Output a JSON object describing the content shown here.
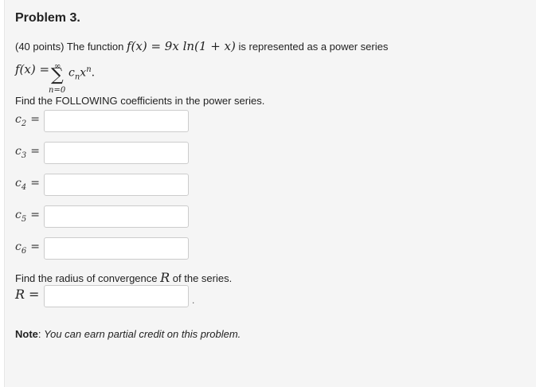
{
  "problem": {
    "title": "Problem 3.",
    "points": "(40 points)",
    "intro_text": "The function",
    "function_expr": "f(x) = 9x ln(1 + x)",
    "intro_tail": "is represented as a power series",
    "series_lhs": "f(x) =",
    "sigma_upper": "∞",
    "sigma_symbol": "∑",
    "sigma_lower": "n=0",
    "series_term": "c",
    "series_sub": "n",
    "series_x": "x",
    "series_sup": "n",
    "series_end": ".",
    "find_coeffs": "Find the FOLLOWING coefficients in the power series.",
    "coefficients": [
      {
        "var": "c",
        "sub": "2",
        "eq": "=",
        "value": ""
      },
      {
        "var": "c",
        "sub": "3",
        "eq": "=",
        "value": ""
      },
      {
        "var": "c",
        "sub": "4",
        "eq": "=",
        "value": ""
      },
      {
        "var": "c",
        "sub": "5",
        "eq": "=",
        "value": ""
      },
      {
        "var": "c",
        "sub": "6",
        "eq": "=",
        "value": ""
      }
    ],
    "find_radius_pre": "Find the radius of convergence",
    "radius_symbol": "R",
    "find_radius_post": "of the series.",
    "radius_label": "R",
    "radius_eq": "=",
    "radius_value": "",
    "radius_period": ".",
    "note_label": "Note",
    "note_colon": ":",
    "note_text": "You can earn partial credit on this problem."
  }
}
